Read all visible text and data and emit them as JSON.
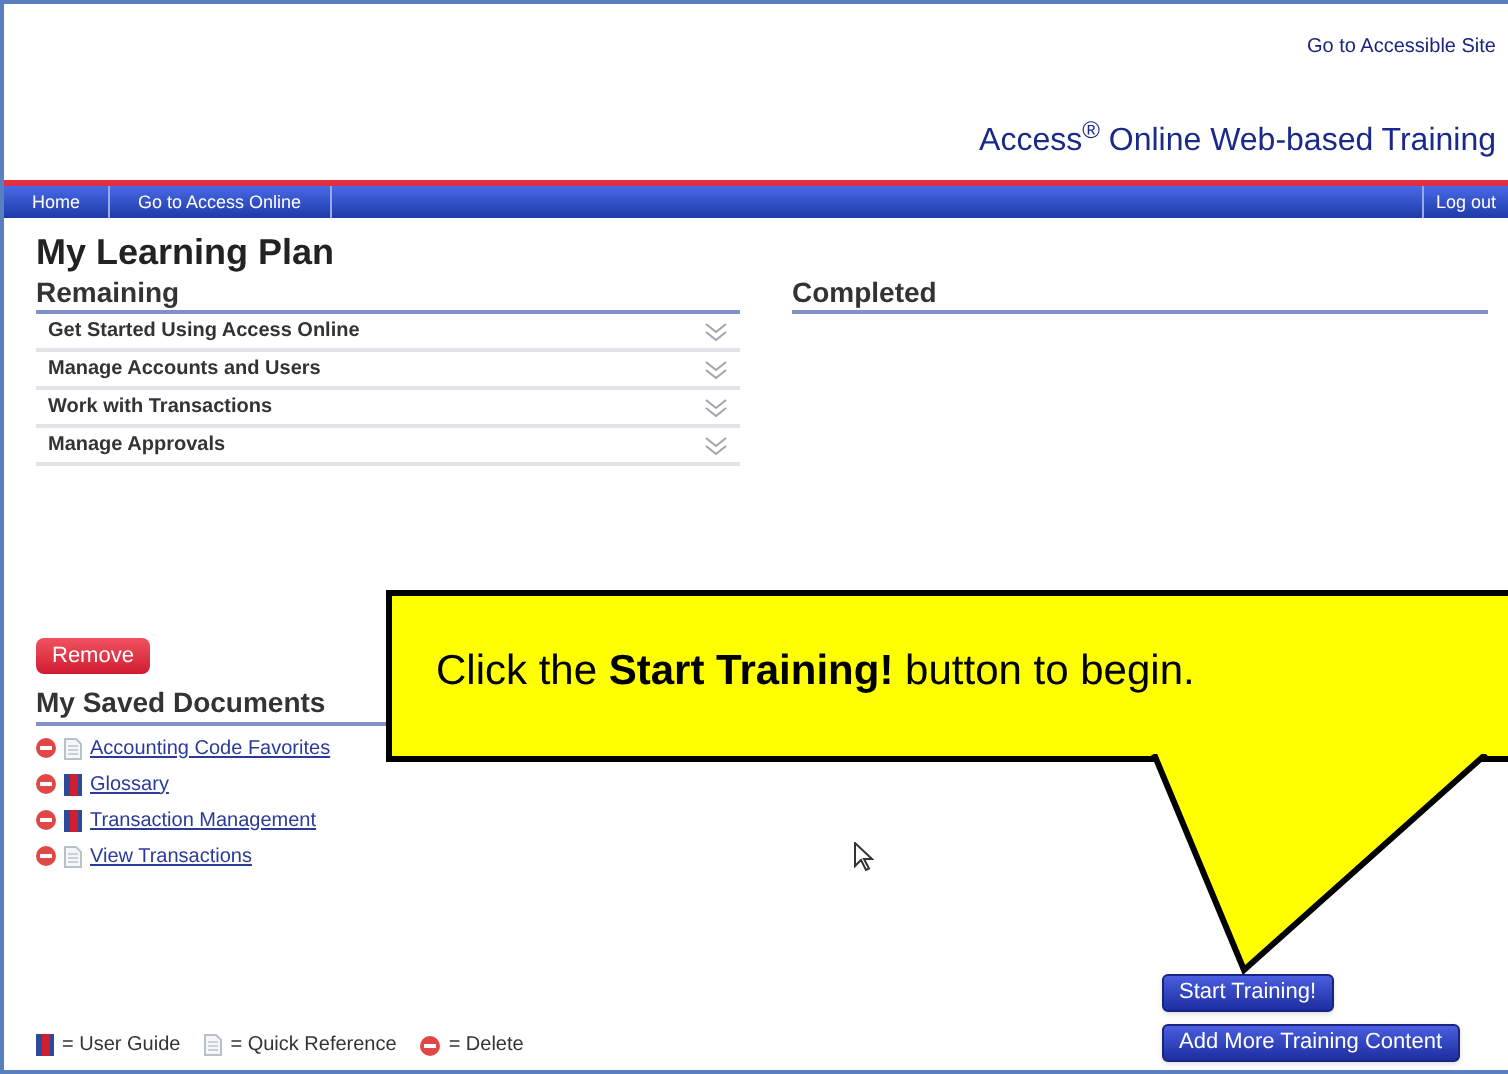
{
  "header": {
    "accessible_link": "Go to Accessible Site",
    "title": "Access$^{®}$ Online Web-based Training"
  },
  "nav": {
    "left": [
      "Home",
      "Go to Access Online"
    ],
    "right": "Log out"
  },
  "page_title": "My Learning Plan",
  "remaining": {
    "heading": "Remaining",
    "items": [
      {
        "label": "Get Started Using Access Online",
        "expanded": false
      },
      {
        "label": "Manage Accounts and Users",
        "expanded": false
      },
      {
        "label": "Work with Transactions",
        "expanded": false
      },
      {
        "label": "Manage Approvals",
        "expanded": false
      }
    ]
  },
  "completed": {
    "heading": "Completed"
  },
  "remove_button": "Remove",
  "saved_documents": {
    "heading": "My Saved Documents",
    "items": [
      {
        "label": "Accounting Code Favorites",
        "kind": "quick_reference"
      },
      {
        "label": "Glossary",
        "kind": "user_guide"
      },
      {
        "label": "Transaction Management",
        "kind": "user_guide"
      },
      {
        "label": "View Transactions",
        "kind": "quick_reference"
      }
    ]
  },
  "legend": [
    {
      "kind": "user_guide",
      "label": "= User Guide"
    },
    {
      "kind": "quick_reference",
      "label": "= Quick Reference"
    },
    {
      "kind": "delete",
      "label": "= Delete"
    }
  ],
  "buttons": [
    "Start Training!",
    "Add More Training Content"
  ],
  "callout": "Click the **Start Training!** button to begin."
}
